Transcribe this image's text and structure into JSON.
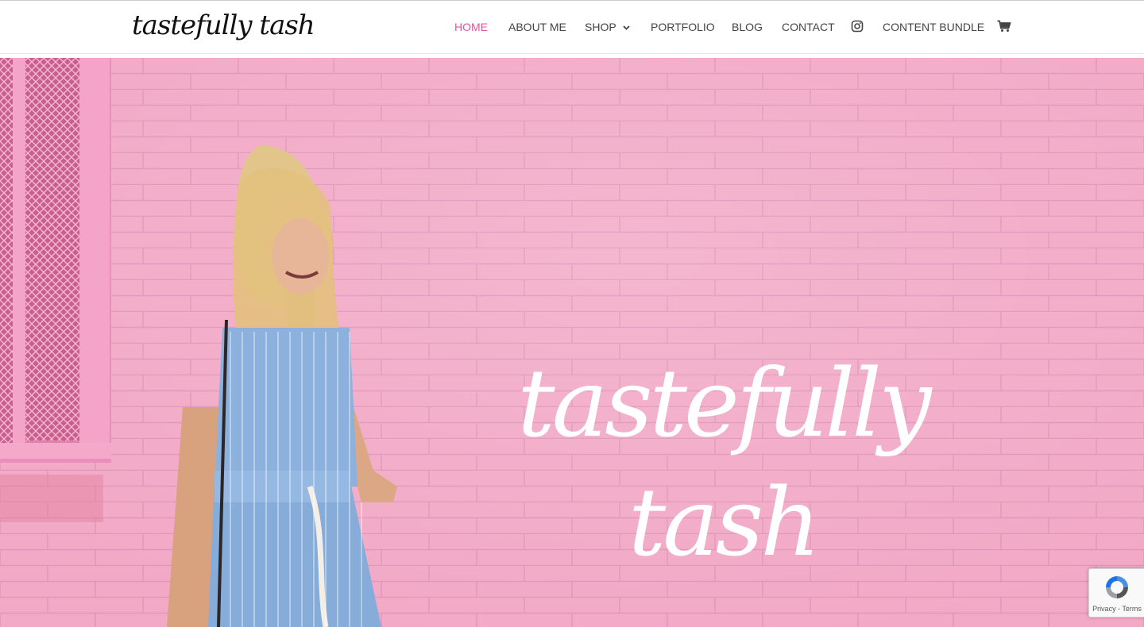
{
  "header": {
    "logo_text": "tastefully tash",
    "nav": [
      {
        "label": "HOME",
        "active": true
      },
      {
        "label": "ABOUT ME"
      },
      {
        "label": "SHOP",
        "has_dropdown": true
      },
      {
        "label": "PORTFOLIO"
      },
      {
        "label": "BLOG"
      },
      {
        "label": "CONTACT"
      }
    ],
    "content_bundle_label": "CONTENT BUNDLE",
    "icons": {
      "instagram": "instagram-icon",
      "cart": "shopping-cart-icon",
      "dropdown": "chevron-down-icon"
    }
  },
  "hero": {
    "wordmark": "tastefully tash",
    "image_subject": "woman-in-blue-striped-jumpsuit-against-pink-brick-wall"
  },
  "recaptcha": {
    "privacy_label": "Privacy",
    "separator": " - ",
    "terms_label": "Terms"
  },
  "colors": {
    "accent": "#e0569f",
    "nav_text": "#444444",
    "hero_pink": "#f2a9c6",
    "wordmark": "#ffffff"
  }
}
